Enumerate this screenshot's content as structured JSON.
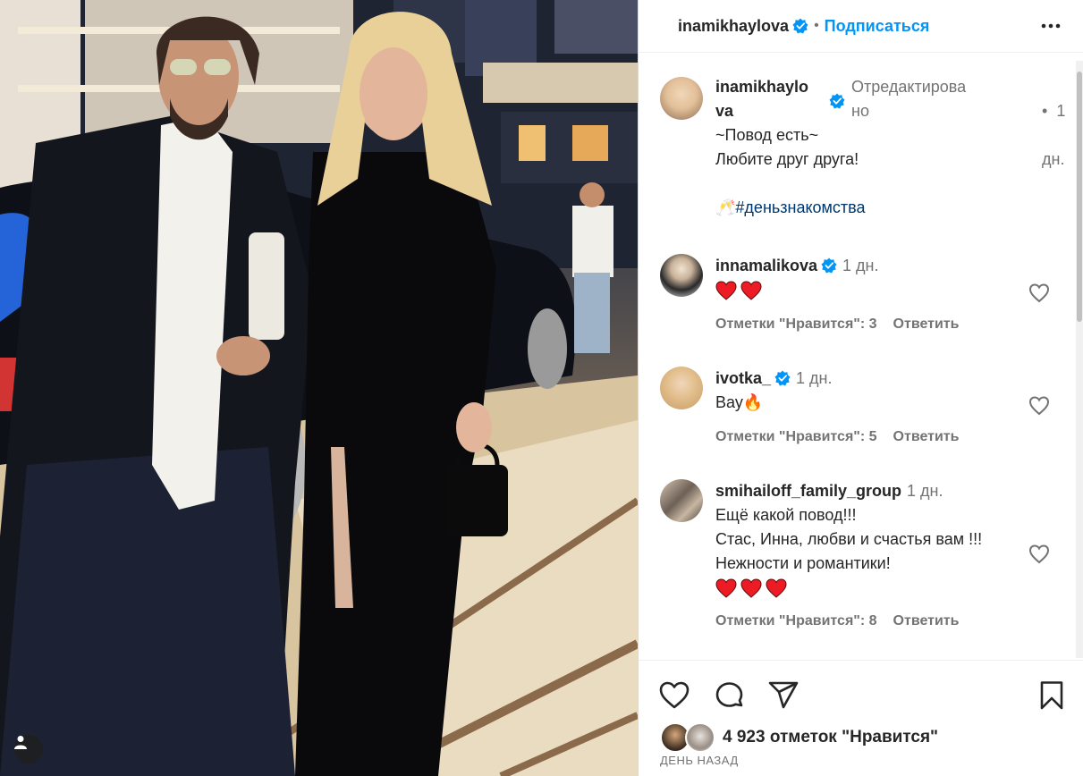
{
  "post": {
    "author": "inamikhaylova",
    "follow_label": "Подписаться",
    "verified": true
  },
  "caption": {
    "username_line1": "inamikhaylo",
    "username_line2": "va",
    "edited_line1": "Отредактирова",
    "edited_line2": "но",
    "time_line1": "•  1",
    "time_line2": "дн.",
    "line1": "~Повод есть~",
    "line2": "Любите друг друга!",
    "hashtag_emoji": "🥂",
    "hashtag": "#деньзнакомства"
  },
  "comments": [
    {
      "username": "innamalikova",
      "verified": true,
      "time": "1 дн.",
      "text": "",
      "hearts": 2,
      "likes_label": "Отметки \"Нравится\": 3",
      "reply_label": "Ответить"
    },
    {
      "username": "ivotka_",
      "verified": true,
      "time": "1 дн.",
      "text": "Вау🔥",
      "hearts": 0,
      "likes_label": "Отметки \"Нравится\": 5",
      "reply_label": "Ответить"
    },
    {
      "username": "smihailoff_family_group",
      "verified": false,
      "time": "1 дн.",
      "text_lines": [
        "Ещё какой повод!!!",
        "Стас, Инна, любви и счастья вам !!!",
        "Нежности и романтики!"
      ],
      "hearts": 3,
      "likes_label": "Отметки \"Нравится\": 8",
      "reply_label": "Ответить"
    }
  ],
  "footer": {
    "likes_text": "4 923 отметок \"Нравится\"",
    "date_text": "ДЕНЬ НАЗАД"
  },
  "icons": [
    "heart-icon",
    "comment-icon",
    "share-icon",
    "bookmark-icon",
    "more-icon",
    "verified-icon",
    "user-tag-icon"
  ],
  "colors": {
    "accent": "#0095f6",
    "verified": "#0095f6",
    "heart_red": "#ed1c24",
    "hashtag": "#00376b",
    "muted": "#737373"
  }
}
